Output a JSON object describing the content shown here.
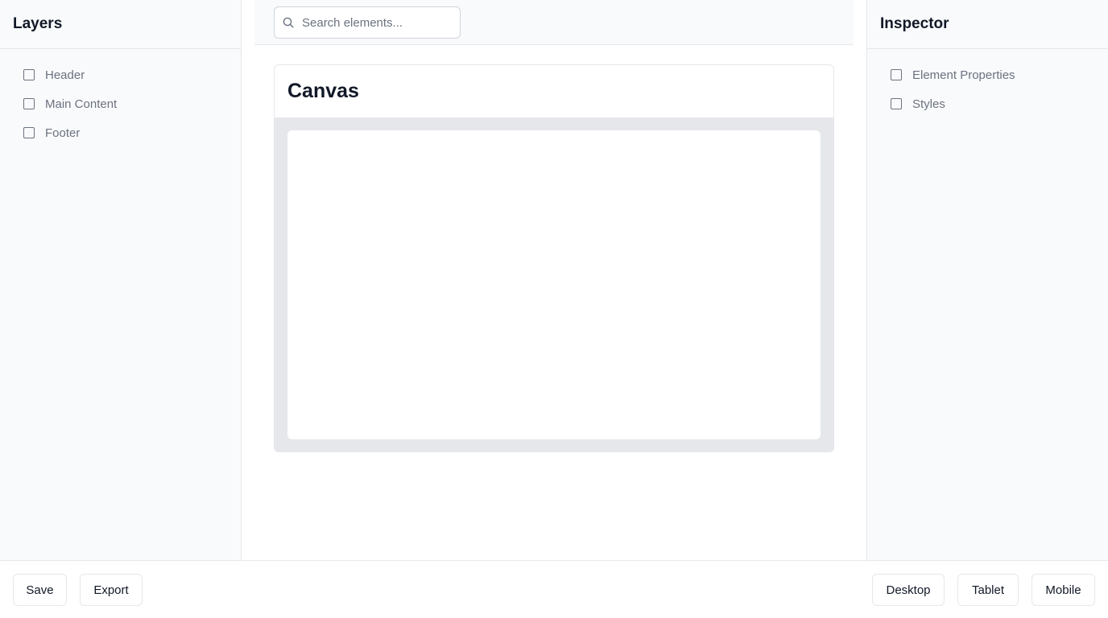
{
  "layers_panel": {
    "title": "Layers",
    "items": [
      {
        "label": "Header"
      },
      {
        "label": "Main Content"
      },
      {
        "label": "Footer"
      }
    ]
  },
  "search": {
    "placeholder": "Search elements...",
    "value": ""
  },
  "canvas": {
    "title": "Canvas"
  },
  "inspector_panel": {
    "title": "Inspector",
    "items": [
      {
        "label": "Element Properties"
      },
      {
        "label": "Styles"
      }
    ]
  },
  "footer": {
    "save_label": "Save",
    "export_label": "Export",
    "desktop_label": "Desktop",
    "tablet_label": "Tablet",
    "mobile_label": "Mobile"
  },
  "icons": {
    "search": "search-icon",
    "checkbox": "checkbox-icon"
  },
  "colors": {
    "panel_bg": "#f9fafb",
    "border": "#e5e7eb",
    "muted_text": "#6b7280",
    "canvas_bg": "#e5e7eb"
  }
}
